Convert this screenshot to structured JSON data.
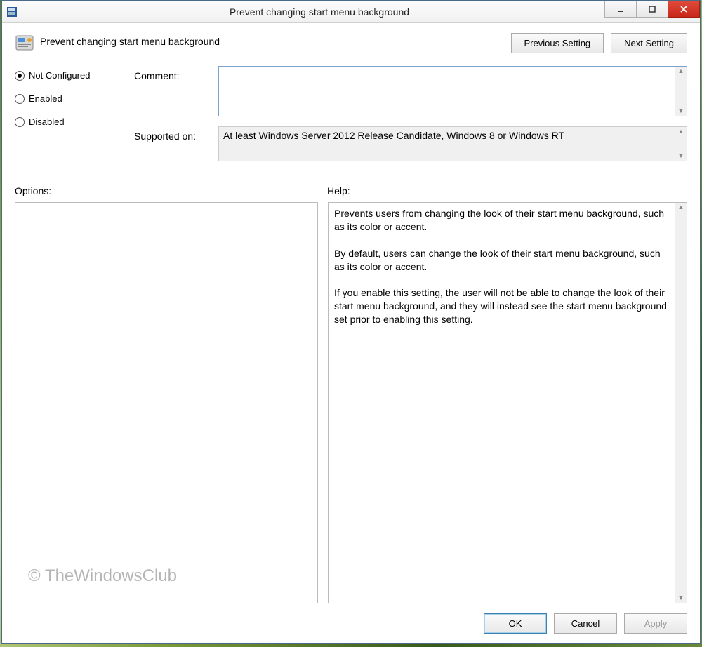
{
  "window": {
    "title": "Prevent changing start menu background"
  },
  "header": {
    "policy_name": "Prevent changing start menu background",
    "prev_btn": "Previous Setting",
    "next_btn": "Next Setting"
  },
  "radios": {
    "not_configured": "Not Configured",
    "enabled": "Enabled",
    "disabled": "Disabled",
    "selected": "not_configured"
  },
  "fields": {
    "comment_label": "Comment:",
    "comment_value": "",
    "supported_label": "Supported on:",
    "supported_value": "At least Windows Server 2012 Release Candidate, Windows 8 or Windows RT"
  },
  "panes": {
    "options_label": "Options:",
    "help_label": "Help:",
    "help_text": "Prevents users from changing the look of their start menu background, such as its color or accent.\n\nBy default, users can change the look of their start menu background, such as its color or accent.\n\nIf you enable this setting, the user will not be able to change the look of their start menu background, and they will instead see the start menu background set prior to enabling this setting."
  },
  "footer": {
    "ok": "OK",
    "cancel": "Cancel",
    "apply": "Apply"
  },
  "watermark": "© TheWindowsClub"
}
